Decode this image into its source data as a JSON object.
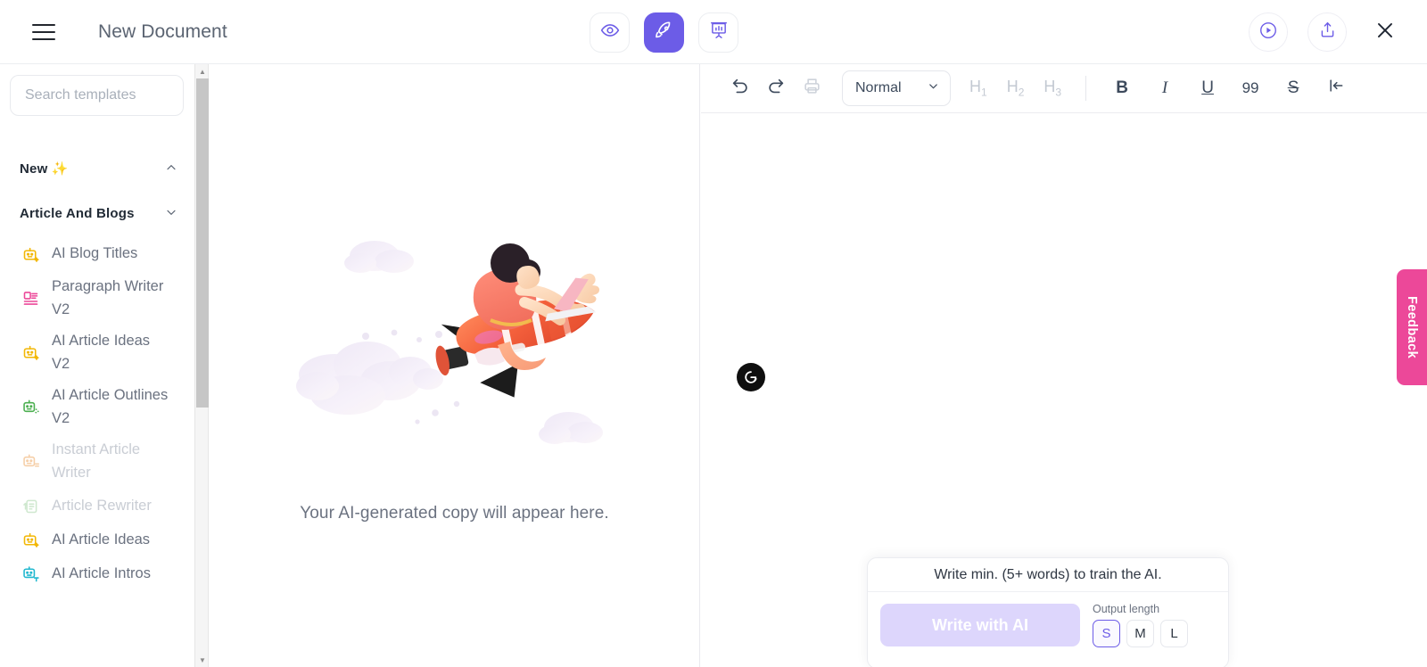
{
  "header": {
    "menu_icon": "hamburger-icon",
    "title": "New Document",
    "center_tabs": [
      {
        "icon": "eye-icon",
        "name": "preview",
        "active": false
      },
      {
        "icon": "rocket-icon",
        "name": "generate",
        "active": true
      },
      {
        "icon": "presentation-chart-icon",
        "name": "insights",
        "active": false
      }
    ],
    "right_actions": [
      {
        "icon": "play-circle-icon",
        "name": "tutorial"
      },
      {
        "icon": "share-upload-icon",
        "name": "share"
      },
      {
        "icon": "close-icon",
        "name": "close"
      }
    ],
    "accent_color": "#6c5ce7"
  },
  "sidebar": {
    "search": {
      "placeholder": "Search templates",
      "value": ""
    },
    "sections": [
      {
        "label": "New ✨",
        "expanded": true,
        "chevron": "chevron-up-icon"
      },
      {
        "label": "Article And Blogs",
        "expanded": false,
        "chevron": "chevron-down-icon"
      }
    ],
    "templates": [
      {
        "label": "AI Blog Titles",
        "icon": "robot-sparkle-icon",
        "color": "#f2b705",
        "dim": false
      },
      {
        "label": "Paragraph Writer V2",
        "icon": "paragraph-icon",
        "color": "#ec4899",
        "dim": false
      },
      {
        "label": "AI Article Ideas V2",
        "icon": "robot-sparkle-icon",
        "color": "#f2b705",
        "dim": false
      },
      {
        "label": "AI Article Outlines V2",
        "icon": "robot-dots-icon",
        "color": "#4caf50",
        "dim": false
      },
      {
        "label": "Instant Article Writer",
        "icon": "robot-lines-icon",
        "color": "#f6cfa8",
        "dim": true
      },
      {
        "label": "Article Rewriter",
        "icon": "rewrite-doc-icon",
        "color": "#cfe8cf",
        "dim": true
      },
      {
        "label": "AI Article Ideas",
        "icon": "robot-sparkle-icon",
        "color": "#f2b705",
        "dim": false
      },
      {
        "label": "AI Article Intros",
        "icon": "robot-text-icon",
        "color": "#22b8cf",
        "dim": false
      }
    ]
  },
  "preview": {
    "illustration": "rocket-person-laptop-illustration",
    "empty_message": "Your AI-generated copy will appear here."
  },
  "editor": {
    "toolbar": {
      "undo": "undo-icon",
      "redo": "redo-icon",
      "print": "printer-icon",
      "style_value": "Normal",
      "style_chevron": "chevron-down-icon",
      "headings": [
        "H1",
        "H2",
        "H3"
      ],
      "bold": "B",
      "italic": "I",
      "underline": "U",
      "quote": "99",
      "strikethrough": "S",
      "outdent": "outdent-icon"
    },
    "grammarly_badge": "grammarly-icon"
  },
  "ai_panel": {
    "hint": "Write min. (5+ words) to train the AI.",
    "write_button": "Write with AI",
    "output_label": "Output length",
    "output_options": [
      "S",
      "M",
      "L"
    ],
    "output_selected": "S"
  },
  "feedback": {
    "label": "Feedback",
    "color": "#ec4899"
  }
}
